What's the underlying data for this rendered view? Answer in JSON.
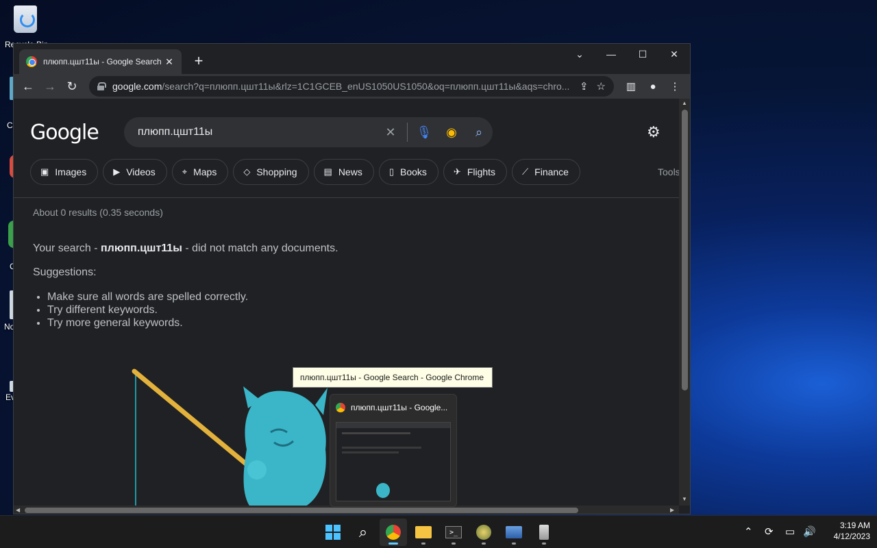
{
  "desktop": {
    "recycle_label": "Recycle Bin",
    "icon_labels": [
      "C",
      "C",
      "No",
      "Ev"
    ]
  },
  "browser": {
    "tab_title": "плюпп.цшт11ы - Google Search",
    "new_tab": "+",
    "url_host": "google.com",
    "url_path": "/search?q=плюпп.цшт11ы&rlz=1C1GCEB_enUS1050US1050&oq=плюпп.цшт11ы&aqs=chro..."
  },
  "search": {
    "logo": "Google",
    "query": "плюпп.цшт11ы",
    "chips": [
      {
        "icon": "images-icon",
        "label": "Images"
      },
      {
        "icon": "videos-icon",
        "label": "Videos"
      },
      {
        "icon": "maps-icon",
        "label": "Maps"
      },
      {
        "icon": "shopping-icon",
        "label": "Shopping"
      },
      {
        "icon": "news-icon",
        "label": "News"
      },
      {
        "icon": "books-icon",
        "label": "Books"
      },
      {
        "icon": "flights-icon",
        "label": "Flights"
      },
      {
        "icon": "finance-icon",
        "label": "Finance"
      }
    ],
    "tools": "Tools",
    "stats": "About 0 results (0.35 seconds)",
    "nomatch_prefix": "Your search - ",
    "nomatch_query": "плюпп.цшт11ы",
    "nomatch_suffix": " - did not match any documents.",
    "suggestions_heading": "Suggestions:",
    "suggestions": [
      "Make sure all words are spelled correctly.",
      "Try different keywords.",
      "Try more general keywords."
    ]
  },
  "tooltip": "плюпп.цшт11ы - Google Search - Google Chrome",
  "preview_title": "плюпп.цшт11ы - Google...",
  "clock": {
    "time": "3:19 AM",
    "date": "4/12/2023"
  },
  "colors": {
    "accent": "#60cdff",
    "mascot": "#3ab6c8",
    "rod": "#e2b23c"
  }
}
